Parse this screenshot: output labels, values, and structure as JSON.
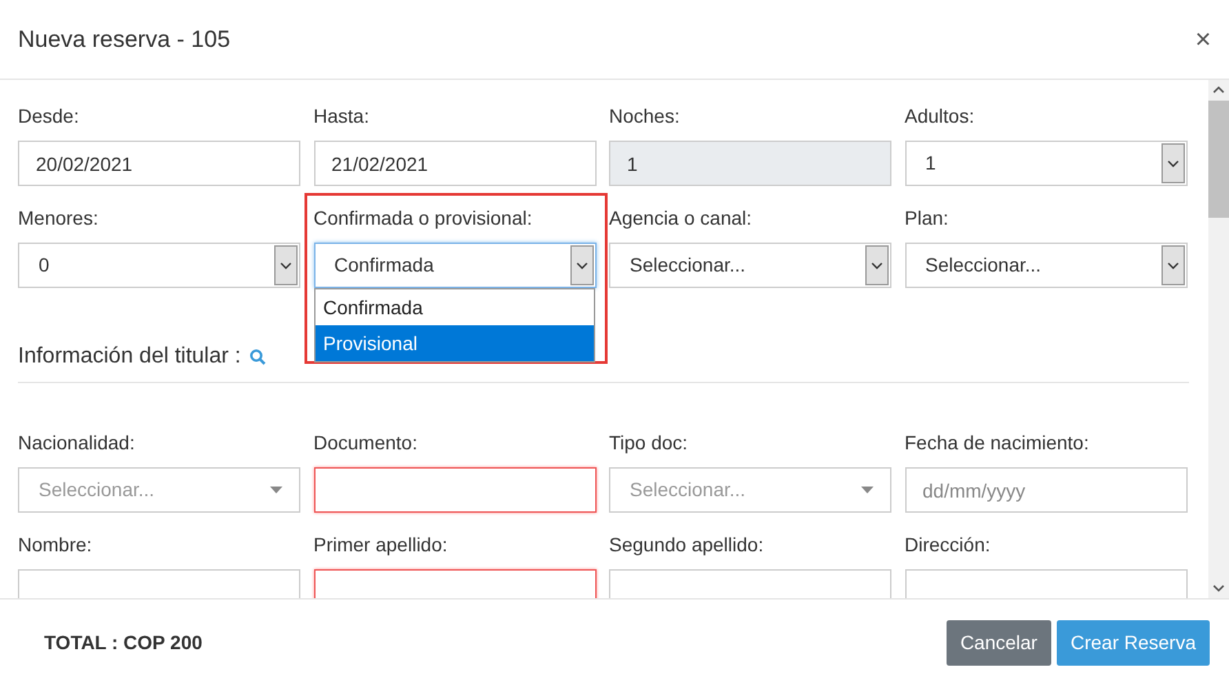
{
  "dialog": {
    "title": "Nueva reserva - 105",
    "close": "×"
  },
  "booking_fields": [
    {
      "label": "Desde:",
      "kind": "text",
      "value": "20/02/2021",
      "disabled": false,
      "invalid": false,
      "highlighted": false
    },
    {
      "label": "Hasta:",
      "kind": "text",
      "value": "21/02/2021",
      "disabled": false,
      "invalid": false,
      "highlighted": false
    },
    {
      "label": "Noches:",
      "kind": "text",
      "value": "1",
      "disabled": true,
      "invalid": false,
      "highlighted": false
    },
    {
      "label": "Adultos:",
      "kind": "select",
      "value": "1",
      "disabled": false,
      "invalid": false,
      "highlighted": false
    },
    {
      "label": "Menores:",
      "kind": "select",
      "value": "0",
      "disabled": false,
      "invalid": false,
      "highlighted": false
    },
    {
      "label": "Confirmada o provisional:",
      "kind": "select",
      "value": "Confirmada",
      "disabled": false,
      "invalid": false,
      "highlighted": true,
      "expanded": true,
      "options": [
        {
          "label": "Confirmada",
          "highlighted": false
        },
        {
          "label": "Provisional",
          "highlighted": true
        }
      ]
    },
    {
      "label": "Agencia o canal:",
      "kind": "select",
      "value": "Seleccionar...",
      "disabled": false,
      "invalid": false,
      "highlighted": false
    },
    {
      "label": "Plan:",
      "kind": "select",
      "value": "Seleccionar...",
      "disabled": false,
      "invalid": false,
      "highlighted": false
    }
  ],
  "holder_section": {
    "title": "Información del titular :"
  },
  "holder_fields": [
    {
      "label": "Nacionalidad:",
      "kind": "combo",
      "placeholder": "Seleccionar...",
      "disabled": false,
      "invalid": false,
      "highlighted": false
    },
    {
      "label": "Documento:",
      "kind": "text",
      "disabled": false,
      "invalid": true,
      "highlighted": false
    },
    {
      "label": "Tipo doc:",
      "kind": "combo",
      "placeholder": "Seleccionar...",
      "disabled": false,
      "invalid": false,
      "highlighted": false
    },
    {
      "label": "Fecha de nacimiento:",
      "kind": "text",
      "placeholder": "dd/mm/yyyy",
      "disabled": false,
      "invalid": false,
      "highlighted": false
    },
    {
      "label": "Nombre:",
      "kind": "text",
      "disabled": false,
      "invalid": false,
      "highlighted": false
    },
    {
      "label": "Primer apellido:",
      "kind": "text",
      "disabled": false,
      "invalid": true,
      "highlighted": false
    },
    {
      "label": "Segundo apellido:",
      "kind": "text",
      "disabled": false,
      "invalid": false,
      "highlighted": false
    },
    {
      "label": "Dirección:",
      "kind": "text",
      "disabled": false,
      "invalid": false,
      "highlighted": false
    }
  ],
  "footer": {
    "total": "TOTAL : COP 200",
    "buttons": [
      {
        "label": "Cancelar",
        "kind": "secondary"
      },
      {
        "label": "Crear Reserva",
        "kind": "primary"
      }
    ]
  }
}
